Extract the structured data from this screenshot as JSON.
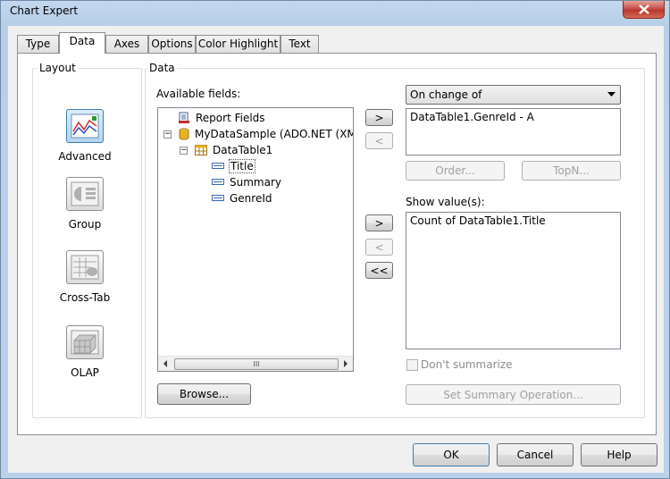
{
  "window": {
    "title": "Chart Expert"
  },
  "tabs": [
    {
      "label": "Type"
    },
    {
      "label": "Data"
    },
    {
      "label": "Axes"
    },
    {
      "label": "Options"
    },
    {
      "label": "Color Highlight"
    },
    {
      "label": "Text"
    }
  ],
  "layout": {
    "group_label": "Layout",
    "items": [
      {
        "label": "Advanced",
        "icon": "advanced-chart-icon",
        "selected": true
      },
      {
        "label": "Group",
        "icon": "group-chart-icon"
      },
      {
        "label": "Cross-Tab",
        "icon": "cross-tab-chart-icon"
      },
      {
        "label": "OLAP",
        "icon": "olap-chart-icon"
      }
    ]
  },
  "data": {
    "group_label": "Data",
    "available_fields_label": "Available fields:",
    "tree": [
      {
        "label": "Report Fields"
      },
      {
        "label": "MyDataSample (ADO.NET (XML))"
      },
      {
        "label": "DataTable1"
      },
      {
        "label": "Title"
      },
      {
        "label": "Summary"
      },
      {
        "label": "GenreId"
      }
    ],
    "browse_button": "Browse...",
    "add_button": ">",
    "remove_button": "<",
    "add_value_button": ">",
    "remove_value_button": "<",
    "remove_all_button": "<<",
    "on_change_dropdown": "On change of",
    "on_change_items": [
      "DataTable1.GenreId - A"
    ],
    "order_button": "Order...",
    "topn_button": "TopN...",
    "show_values_label": "Show value(s):",
    "show_values_items": [
      "Count of DataTable1.Title"
    ],
    "dont_summarize_label": "Don't summarize",
    "set_summary_button": "Set Summary Operation...",
    "scroll_thumb_grip": "III"
  },
  "footer": {
    "ok_button": "OK",
    "cancel_button": "Cancel",
    "help_button": "Help"
  }
}
